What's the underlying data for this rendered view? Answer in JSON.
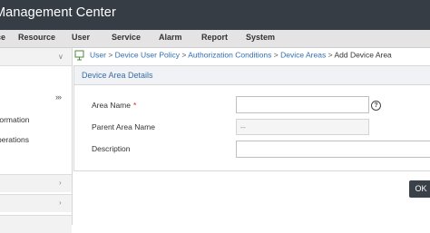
{
  "app": {
    "title": "Management Center"
  },
  "menu": {
    "items": [
      {
        "label": "ce"
      },
      {
        "label": "Resource"
      },
      {
        "label": "User"
      },
      {
        "label": "Service"
      },
      {
        "label": "Alarm"
      },
      {
        "label": "Report"
      },
      {
        "label": "System"
      }
    ]
  },
  "sidebar": {
    "collapse_glyph": "›››",
    "chevron_down": "∨",
    "chevron_right": "›",
    "items": [
      {
        "label": "formation"
      },
      {
        "label": "perations"
      }
    ]
  },
  "breadcrumb": {
    "links": [
      "User",
      "Device User Policy",
      "Authorization Conditions",
      "Device Areas"
    ],
    "current": "Add Device Area",
    "separator": ">"
  },
  "form": {
    "title": "Device Area Details",
    "fields": {
      "area_name": {
        "label": "Area Name",
        "required_mark": "*",
        "value": ""
      },
      "parent_area": {
        "label": "Parent Area Name",
        "value": "--"
      },
      "description": {
        "label": "Description",
        "value": ""
      }
    },
    "help_glyph": "?"
  },
  "actions": {
    "ok_label": "OK"
  }
}
